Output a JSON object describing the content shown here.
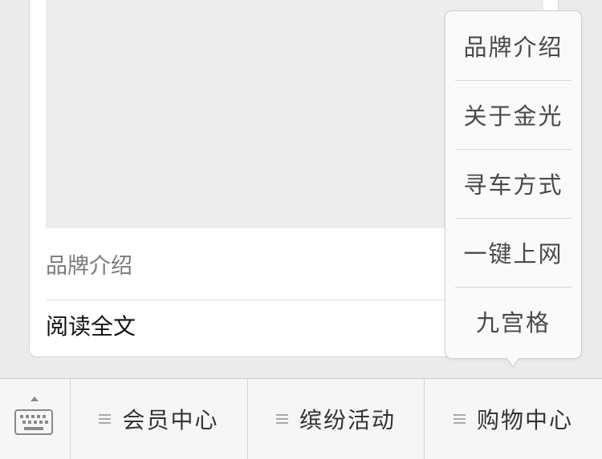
{
  "article": {
    "title": "品牌介绍",
    "read_more": "阅读全文"
  },
  "popup_menu": {
    "items": [
      {
        "label": "品牌介绍"
      },
      {
        "label": "关于金光"
      },
      {
        "label": "寻车方式"
      },
      {
        "label": "一键上网"
      },
      {
        "label": "九宫格"
      }
    ]
  },
  "bottom_menu": {
    "tabs": [
      {
        "label": "会员中心"
      },
      {
        "label": "缤纷活动"
      },
      {
        "label": "购物中心"
      }
    ]
  },
  "icons": {
    "keyboard": "keyboard-icon",
    "caret": "caret-up-icon",
    "menu": "hamburger-icon"
  }
}
